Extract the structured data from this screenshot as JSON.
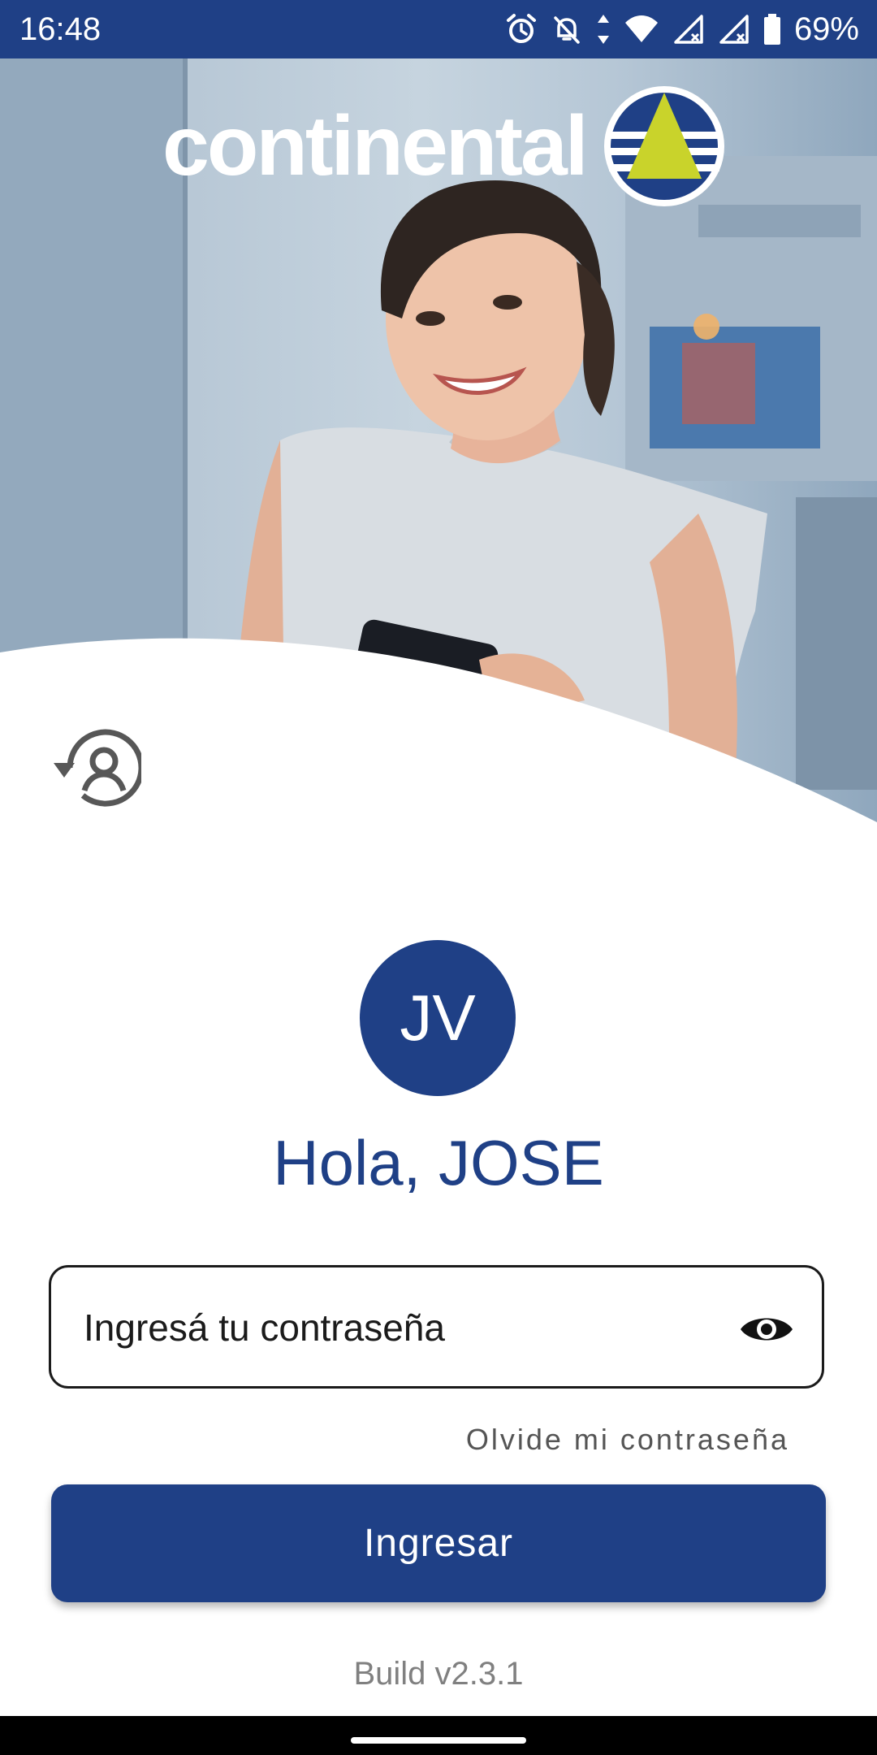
{
  "status_bar": {
    "time": "16:48",
    "battery": "69%",
    "icons": [
      "alarm-icon",
      "notifications-off-icon",
      "data-arrows-icon",
      "wifi-icon",
      "signal-icon",
      "signal-icon",
      "battery-icon"
    ]
  },
  "brand": {
    "logo_text": "continental",
    "primary_color": "#1f4086",
    "accent_color": "#c9d32b"
  },
  "profile": {
    "initials": "JV",
    "greeting": "Hola,  JOSE"
  },
  "login": {
    "password_placeholder": "Ingresá tu contraseña",
    "forgot_password": "Olvide mi contraseña",
    "submit_label": "Ingresar"
  },
  "footer": {
    "build": "Build v2.3.1"
  }
}
